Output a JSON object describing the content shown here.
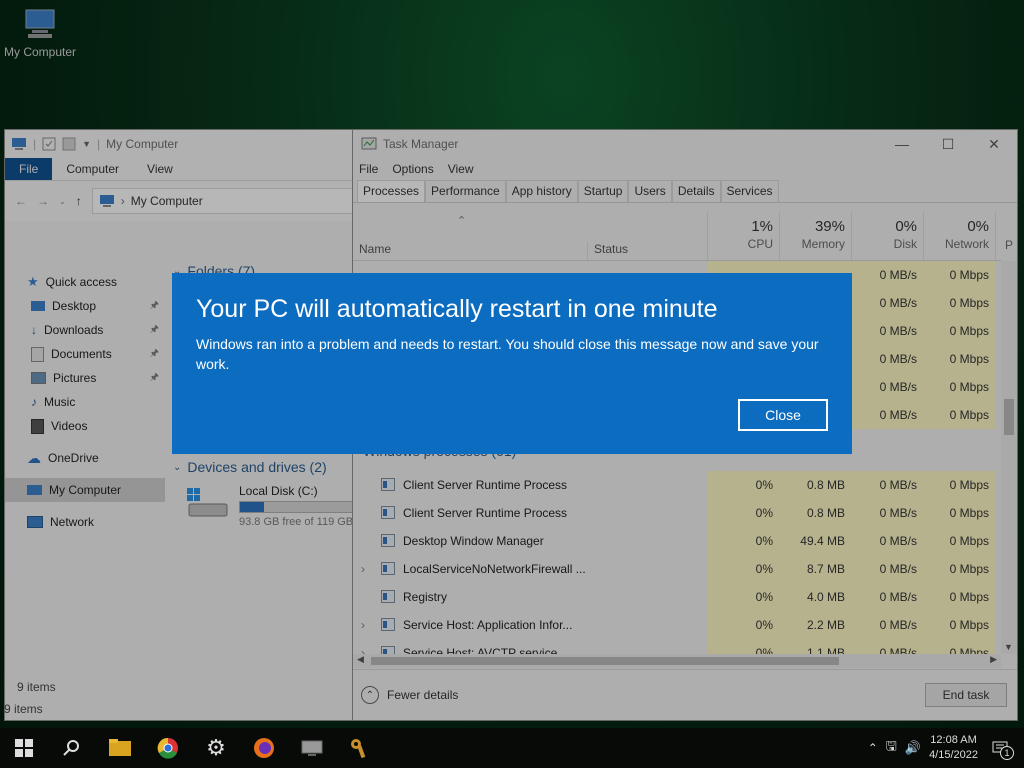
{
  "desktop": {
    "icon_label": "My Computer"
  },
  "explorer": {
    "title": "My Computer",
    "ribbon_tabs": [
      "File",
      "Computer",
      "View"
    ],
    "address": "My Computer",
    "nav_items": [
      {
        "label": "Quick access",
        "icon": "star-icon"
      },
      {
        "label": "Desktop",
        "icon": "desktop-icon"
      },
      {
        "label": "Downloads",
        "icon": "download-icon"
      },
      {
        "label": "Documents",
        "icon": "documents-icon"
      },
      {
        "label": "Pictures",
        "icon": "pictures-icon"
      },
      {
        "label": "Music",
        "icon": "music-icon"
      },
      {
        "label": "Videos",
        "icon": "videos-icon"
      },
      {
        "label": "OneDrive",
        "icon": "cloud-icon"
      },
      {
        "label": "My Computer",
        "icon": "computer-icon"
      },
      {
        "label": "Network",
        "icon": "network-icon"
      }
    ],
    "folders_header": "Folders (7)",
    "devices_header": "Devices and drives (2)",
    "drive": {
      "name": "Local Disk (C:)",
      "free_text": "93.8 GB free of 119 GB",
      "used_fraction": 0.21
    },
    "status_items": "9 items",
    "status_items_bottom": "9 items"
  },
  "taskmanager": {
    "title": "Task Manager",
    "menu": [
      "File",
      "Options",
      "View"
    ],
    "tabs": [
      "Processes",
      "Performance",
      "App history",
      "Startup",
      "Users",
      "Details",
      "Services"
    ],
    "columns": {
      "name": "Name",
      "status": "Status",
      "cpu_pct": "1%",
      "cpu": "CPU",
      "mem_pct": "39%",
      "mem": "Memory",
      "disk_pct": "0%",
      "disk": "Disk",
      "net_pct": "0%",
      "net": "Network",
      "power": "P"
    },
    "group_windows": "Windows processes (61)",
    "top_rows": [
      {
        "disk": "0 MB/s",
        "net": "0 Mbps"
      },
      {
        "disk": "0 MB/s",
        "net": "0 Mbps"
      },
      {
        "disk": "0 MB/s",
        "net": "0 Mbps"
      },
      {
        "disk": "0 MB/s",
        "net": "0 Mbps"
      },
      {
        "disk": "0 MB/s",
        "net": "0 Mbps"
      },
      {
        "disk": "0 MB/s",
        "net": "0 Mbps"
      }
    ],
    "processes": [
      {
        "name": "Client Server Runtime Process",
        "cpu": "0%",
        "mem": "0.8 MB",
        "disk": "0 MB/s",
        "net": "0 Mbps",
        "expandable": false
      },
      {
        "name": "Client Server Runtime Process",
        "cpu": "0%",
        "mem": "0.8 MB",
        "disk": "0 MB/s",
        "net": "0 Mbps",
        "expandable": false
      },
      {
        "name": "Desktop Window Manager",
        "cpu": "0%",
        "mem": "49.4 MB",
        "disk": "0 MB/s",
        "net": "0 Mbps",
        "expandable": false
      },
      {
        "name": "LocalServiceNoNetworkFirewall ...",
        "cpu": "0%",
        "mem": "8.7 MB",
        "disk": "0 MB/s",
        "net": "0 Mbps",
        "expandable": true
      },
      {
        "name": "Registry",
        "cpu": "0%",
        "mem": "4.0 MB",
        "disk": "0 MB/s",
        "net": "0 Mbps",
        "expandable": false
      },
      {
        "name": "Service Host: Application Infor...",
        "cpu": "0%",
        "mem": "2.2 MB",
        "disk": "0 MB/s",
        "net": "0 Mbps",
        "expandable": true
      },
      {
        "name": "Service Host: AVCTP service",
        "cpu": "0%",
        "mem": "1.1 MB",
        "disk": "0 MB/s",
        "net": "0 Mbps",
        "expandable": true
      }
    ],
    "fewer_details": "Fewer details",
    "end_task": "End task"
  },
  "dialog": {
    "title": "Your PC will automatically restart in one minute",
    "message": "Windows ran into a problem and needs to restart. You should close this message now and save your work.",
    "close_label": "Close",
    "bg_color": "#0c6cc0"
  },
  "taskbar": {
    "apps": [
      "start-icon",
      "search-icon",
      "file-explorer-icon",
      "chrome-icon",
      "settings-icon",
      "firefox-icon",
      "network-drive-icon",
      "keys-icon"
    ],
    "time": "12:08 AM",
    "date": "4/15/2022",
    "notification_count": "1"
  }
}
